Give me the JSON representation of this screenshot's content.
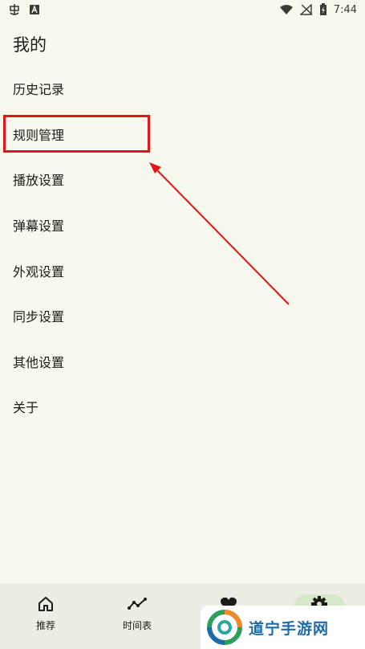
{
  "status_bar": {
    "time": "7:44"
  },
  "page": {
    "title": "我的"
  },
  "menu": {
    "items": [
      {
        "label": "历史记录"
      },
      {
        "label": "规则管理"
      },
      {
        "label": "播放设置"
      },
      {
        "label": "弹幕设置"
      },
      {
        "label": "外观设置"
      },
      {
        "label": "同步设置"
      },
      {
        "label": "其他设置"
      },
      {
        "label": "关于"
      }
    ]
  },
  "bottom_nav": {
    "items": [
      {
        "label": "推荐",
        "icon": "home-icon"
      },
      {
        "label": "时间表",
        "icon": "timeline-icon"
      },
      {
        "label": "",
        "icon": "heart-icon"
      },
      {
        "label": "",
        "icon": "gear-icon"
      }
    ]
  },
  "annotation": {
    "color": "#e31616"
  },
  "watermark": {
    "text": "道宁手游网"
  },
  "colors": {
    "background": "#f7f9ef",
    "nav_background": "#eceee3",
    "active_pill": "#d6e8c8"
  }
}
